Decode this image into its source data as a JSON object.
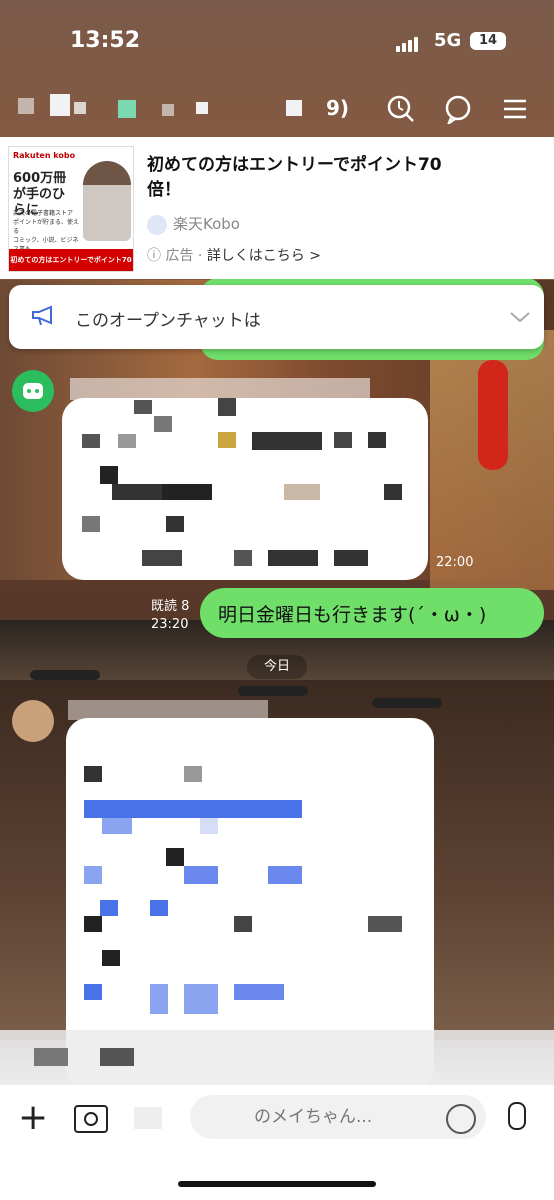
{
  "status_bar": {
    "time": "13:52",
    "network": "5G",
    "battery": "14"
  },
  "header": {
    "title_fragment": "9)"
  },
  "ad": {
    "image_brand": "Rakuten kobo",
    "image_headline": "600万冊が手のひらに",
    "image_features": [
      "楽天の電子書籍ストア",
      "ポイントが貯まる、使える",
      "コミック、小説、ビジネス書も"
    ],
    "image_banner": "初めての方はエントリーでポイント70倍",
    "headline": "初めての方はエントリーでポイント70倍！",
    "sponsor": "楽天Kobo",
    "label": "広告",
    "cta": "詳しくはこちら >"
  },
  "notice": {
    "text": "このオープンチャットは"
  },
  "messages": {
    "incoming_time": "22:00",
    "read_label": "既読 8",
    "read_time": "23:20",
    "outgoing_text": "明日金曜日も行きます(´・ω・)",
    "day_separator": "今日"
  },
  "input": {
    "placeholder": "のメイちゃん..."
  },
  "colors": {
    "green_bubble": "#6fdf6a",
    "accent_blue": "#4a72e8"
  }
}
